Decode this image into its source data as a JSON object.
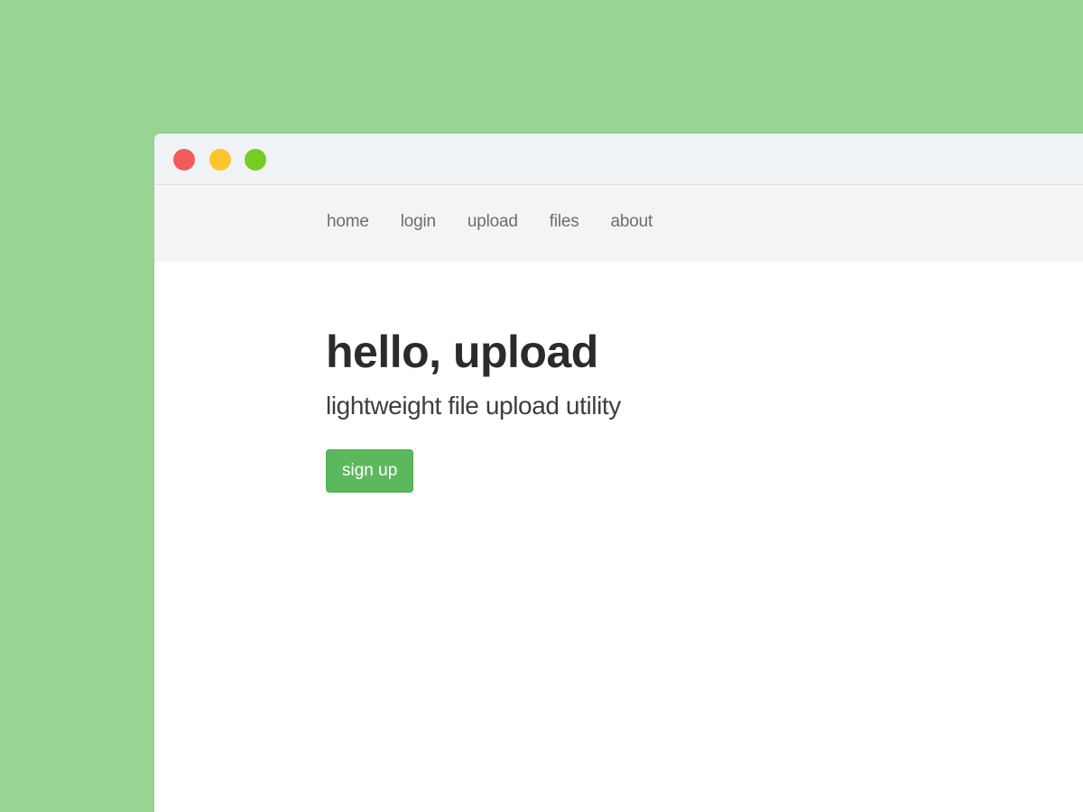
{
  "window": {
    "controls": [
      {
        "name": "close",
        "color": "#f25b5b"
      },
      {
        "name": "minimize",
        "color": "#fdc42d"
      },
      {
        "name": "maximize",
        "color": "#73cd24"
      }
    ]
  },
  "nav": {
    "items": [
      {
        "label": "home"
      },
      {
        "label": "login"
      },
      {
        "label": "upload"
      },
      {
        "label": "files"
      },
      {
        "label": "about"
      }
    ]
  },
  "hero": {
    "title": "hello, upload",
    "subtitle": "lightweight file upload utility",
    "button_label": "sign up"
  },
  "colors": {
    "background": "#98d494",
    "accent": "#5cb85c",
    "navbar": "#f4f4f4",
    "titlebar": "#f0f3f5"
  }
}
